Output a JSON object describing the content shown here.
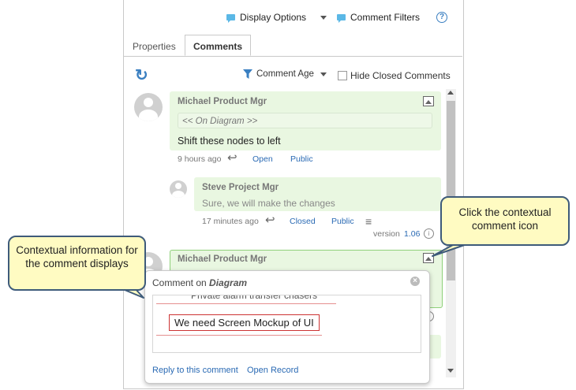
{
  "toolbar": {
    "display_options": "Display Options",
    "comment_filters": "Comment Filters",
    "help": "?"
  },
  "tabs": [
    {
      "label": "Properties"
    },
    {
      "label": "Comments"
    }
  ],
  "filter": {
    "sort_label": "Comment Age",
    "hide_closed_label": "Hide Closed Comments"
  },
  "comments": [
    {
      "author": "Michael Product Mgr",
      "context": "<< On Diagram >>",
      "text": "Shift these nodes to left",
      "age": "9 hours ago",
      "status": "Open",
      "visibility": "Public"
    },
    {
      "author": "Steve Project Mgr",
      "text": "Sure, we will make the changes",
      "age": "17 minutes ago",
      "status": "Closed",
      "visibility": "Public",
      "version_label": "version",
      "version": "1.06"
    },
    {
      "author": "Michael Product Mgr"
    }
  ],
  "popup": {
    "title_prefix": "Comment on",
    "title_target": "Diagram",
    "clipped_text": "Private alarm transfer chasers",
    "highlight_text": "We need Screen Mockup of UI",
    "reply_link": "Reply to this comment",
    "open_record_link": "Open Record"
  },
  "callouts": {
    "left": "Contextual information for the comment displays",
    "right": "Click the contextual comment icon"
  },
  "colors": {
    "accent": "#2a6ab4",
    "comment_bg": "#e9f7e1",
    "callout_bg": "#fffbc2",
    "callout_border": "#3e5b7a",
    "highlight_border": "#cc3333"
  }
}
